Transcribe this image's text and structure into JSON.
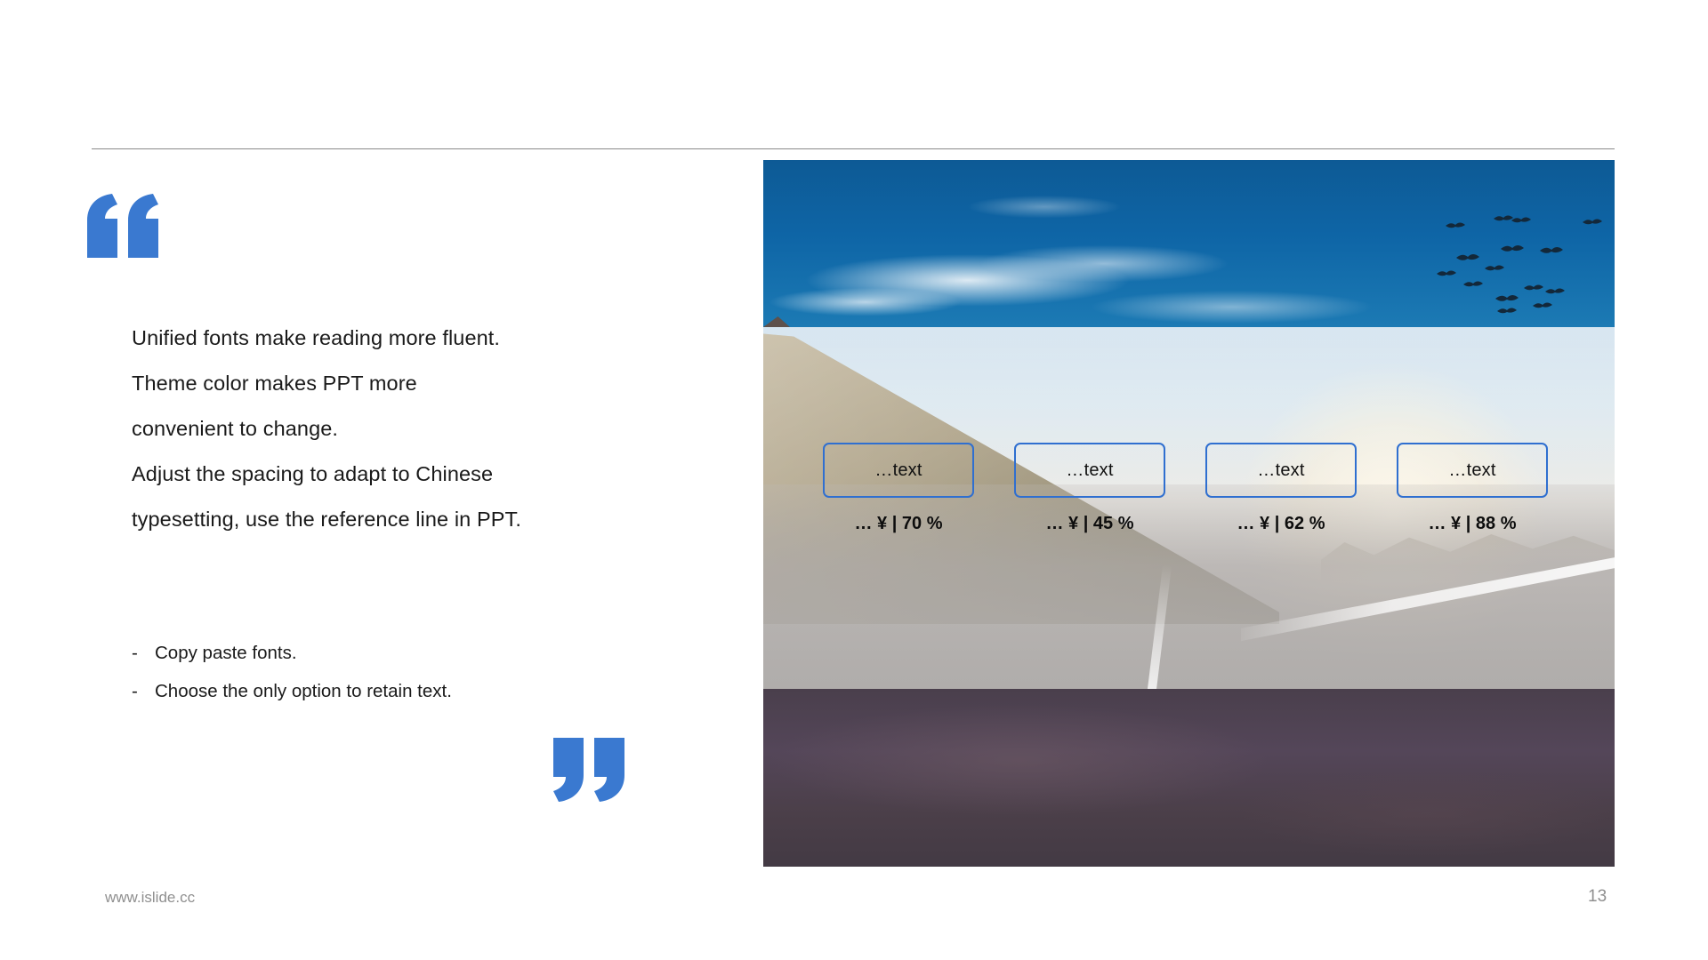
{
  "slide": {
    "page_number": "13",
    "footer_url": "www.islide.cc",
    "accent_color": "#3a79d0",
    "card_border_color": "#2f6fd0",
    "rule_color": "#8a8a8a"
  },
  "quote": {
    "open_mark_icon": "quote-open-icon",
    "close_mark_icon": "quote-close-icon",
    "paragraph_lines": [
      "Unified fonts make reading more fluent.",
      "Theme color makes PPT more",
      "convenient to change.",
      "Adjust the spacing to adapt to Chinese",
      "typesetting, use the reference line in PPT."
    ],
    "bullets": [
      {
        "dash": "-",
        "text": "Copy paste fonts."
      },
      {
        "dash": "-",
        "text": "Choose the only option to retain text."
      }
    ]
  },
  "photo": {
    "alt_name": "road-sunset-photo",
    "bands": [
      {
        "name": "deep-blue-sky-with-birds"
      },
      {
        "name": "hazy-mountain-road"
      },
      {
        "name": "dark-asphalt"
      }
    ]
  },
  "cards": [
    {
      "label": "…text",
      "stat": "…  ¥  | 70 %",
      "percent": 70
    },
    {
      "label": "…text",
      "stat": "…  ¥  | 45 %",
      "percent": 45
    },
    {
      "label": "…text",
      "stat": "…  ¥  | 62 %",
      "percent": 62
    },
    {
      "label": "…text",
      "stat": "…  ¥  | 88 %",
      "percent": 88
    }
  ]
}
